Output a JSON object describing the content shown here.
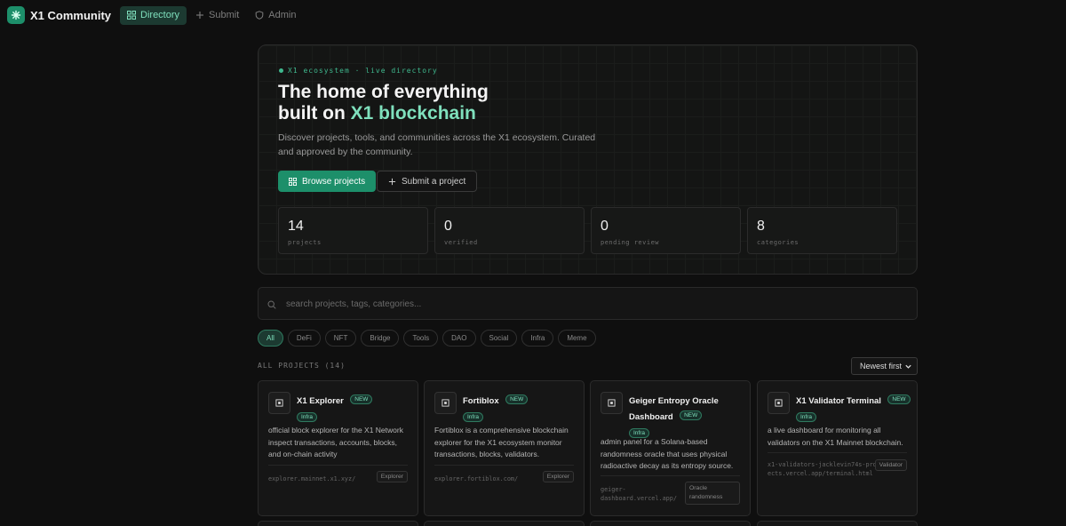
{
  "nav": {
    "brand": "X1 Community",
    "items": [
      {
        "label": "Directory",
        "icon": "grid-icon",
        "active": true
      },
      {
        "label": "Submit",
        "icon": "plus-icon",
        "active": false
      },
      {
        "label": "Admin",
        "icon": "shield-icon",
        "active": false
      }
    ]
  },
  "hero": {
    "eyebrow": "X1 ecosystem · live directory",
    "title_line1": "The home of everything",
    "title_line2_prefix": "built on ",
    "title_line2_accent": "X1 blockchain",
    "description": "Discover projects, tools, and communities across the X1 ecosystem. Curated and approved by the community.",
    "primary_button": "Browse projects",
    "secondary_button": "Submit a project",
    "stats": [
      {
        "value": "14",
        "label": "projects"
      },
      {
        "value": "0",
        "label": "verified"
      },
      {
        "value": "0",
        "label": "pending review"
      },
      {
        "value": "8",
        "label": "categories"
      }
    ]
  },
  "search": {
    "placeholder": "search projects, tags, categories..."
  },
  "filters": [
    "All",
    "DeFi",
    "NFT",
    "Bridge",
    "Tools",
    "DAO",
    "Social",
    "Infra",
    "Meme"
  ],
  "active_filter": "All",
  "section_label": "ALL PROJECTS (14)",
  "sort": {
    "selected": "Newest first"
  },
  "cards": [
    {
      "name": "X1 Explorer",
      "badge": "NEW",
      "tag": "Infra",
      "description": "official block explorer for the X1 Network inspect transactions, accounts, blocks, and on-chain activity",
      "url": "explorer.mainnet.x1.xyz/",
      "category": "Explorer"
    },
    {
      "name": "Fortiblox",
      "badge": "NEW",
      "tag": "Infra",
      "description": "Fortiblox is a comprehensive blockchain explorer for the X1 ecosystem monitor transactions, blocks, validators.",
      "url": "explorer.fortiblox.com/",
      "category": "Explorer"
    },
    {
      "name": "Geiger Entropy Oracle Dashboard",
      "badge": "NEW",
      "tag": "Infra",
      "description": "admin panel for a Solana-based randomness oracle that uses physical radioactive decay as its entropy source.",
      "url": "geiger-dashboard.vercel.app/",
      "category": "Oracle randomness"
    },
    {
      "name": "X1 Validator Terminal",
      "badge": "NEW",
      "tag": "Infra",
      "description": "a live dashboard for monitoring all validators on the X1 Mainnet blockchain.",
      "url": "x1-validators-jacklevin74s-projects.vercel.app/terminal.html",
      "category": "Validator"
    }
  ],
  "colors": {
    "accent": "#1d8f6a",
    "accent_text": "#7fe0bd",
    "background": "#0f0f0f"
  }
}
